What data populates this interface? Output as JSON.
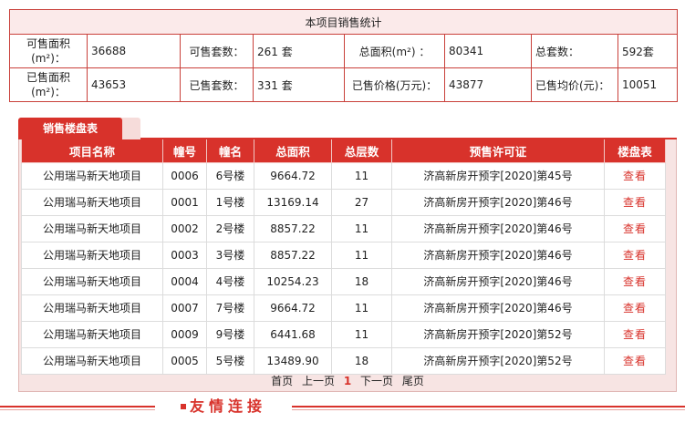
{
  "stats": {
    "title": "本项目销售统计",
    "available_area_label": "可售面积\n(m²)：",
    "available_area_value": "36688",
    "available_units_label": "可售套数：",
    "available_units_value": "261 套",
    "total_area_label": "总面积(m²) ：",
    "total_area_value": "80341",
    "total_units_label": "总套数：",
    "total_units_value": "592套",
    "sold_area_label": "已售面积\n(m²)：",
    "sold_area_value": "43653",
    "sold_units_label": "已售套数：",
    "sold_units_value": "331 套",
    "sold_price_label": "已售价格(万元)：",
    "sold_price_value": "43877",
    "avg_price_label": "已售均价(元)：",
    "avg_price_value": "10051"
  },
  "tab": {
    "label": "销售楼盘表"
  },
  "table": {
    "headers": [
      "项目名称",
      "幢号",
      "幢名",
      "总面积",
      "总层数",
      "预售许可证",
      "楼盘表"
    ],
    "rows": [
      [
        "公用瑞马新天地项目",
        "0006",
        "6号楼",
        "9664.72",
        "11",
        "济高新房开预字[2020]第45号",
        "查看"
      ],
      [
        "公用瑞马新天地项目",
        "0001",
        "1号楼",
        "13169.14",
        "27",
        "济高新房开预字[2020]第46号",
        "查看"
      ],
      [
        "公用瑞马新天地项目",
        "0002",
        "2号楼",
        "8857.22",
        "11",
        "济高新房开预字[2020]第46号",
        "查看"
      ],
      [
        "公用瑞马新天地项目",
        "0003",
        "3号楼",
        "8857.22",
        "11",
        "济高新房开预字[2020]第46号",
        "查看"
      ],
      [
        "公用瑞马新天地项目",
        "0004",
        "4号楼",
        "10254.23",
        "18",
        "济高新房开预字[2020]第46号",
        "查看"
      ],
      [
        "公用瑞马新天地项目",
        "0007",
        "7号楼",
        "9664.72",
        "11",
        "济高新房开预字[2020]第46号",
        "查看"
      ],
      [
        "公用瑞马新天地项目",
        "0009",
        "9号楼",
        "6441.68",
        "11",
        "济高新房开预字[2020]第52号",
        "查看"
      ],
      [
        "公用瑞马新天地项目",
        "0005",
        "5号楼",
        "13489.90",
        "18",
        "济高新房开预字[2020]第52号",
        "查看"
      ]
    ]
  },
  "pager": {
    "first": "首页",
    "prev": "上一页",
    "current": "1",
    "next": "下一页",
    "last": "尾页"
  },
  "footer": {
    "title": "友情连接"
  },
  "colors": {
    "accent": "#d8322b",
    "panel_bg": "#f7e4e3",
    "title_bg": "#fbeaea"
  }
}
